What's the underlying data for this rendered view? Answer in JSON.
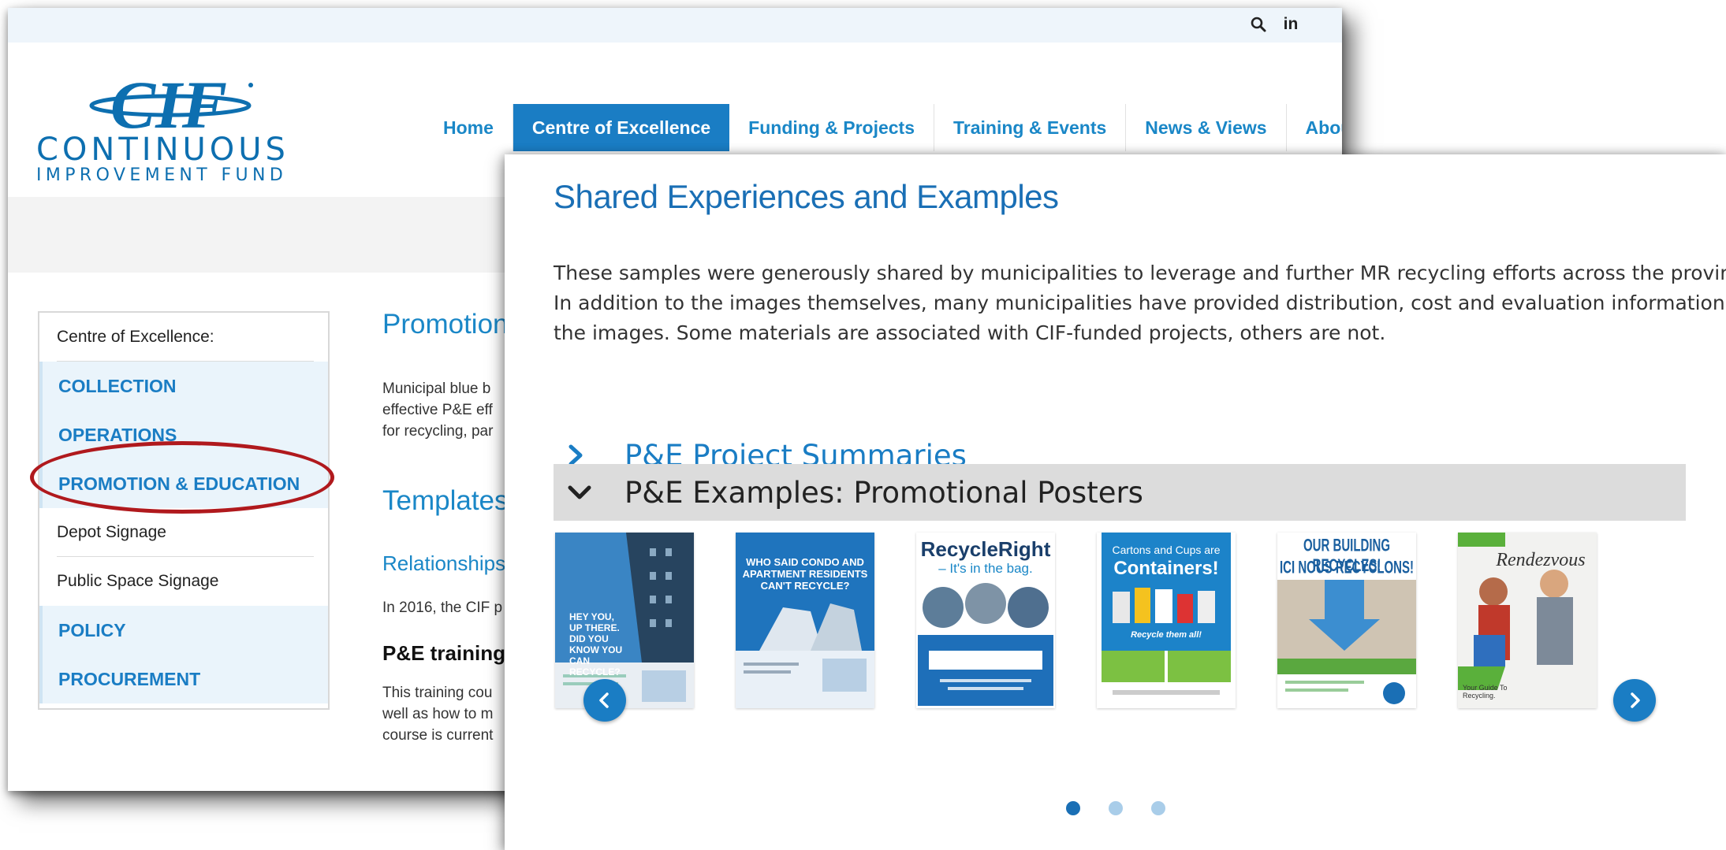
{
  "topbar": {
    "search_icon": "search-icon",
    "linkedin_label": "in"
  },
  "logo": {
    "letters": "CIF",
    "line1": "CONTINUOUS",
    "line2": "IMPROVEMENT FUND",
    "color": "#0d6fb0"
  },
  "nav": {
    "items": [
      "Home",
      "Centre of Excellence",
      "Funding & Projects",
      "Training & Events",
      "News & Views",
      "About"
    ],
    "active_index": 1,
    "active_color": "#1a7dc4"
  },
  "sidebar": {
    "heading": "Centre of Excellence:",
    "items": [
      {
        "label": "COLLECTION",
        "type": "category"
      },
      {
        "label": "OPERATIONS",
        "type": "category"
      },
      {
        "label": "PROMOTION & EDUCATION",
        "type": "category",
        "highlighted": true
      },
      {
        "label": "Depot Signage",
        "type": "sub"
      },
      {
        "label": "Public Space Signage",
        "type": "sub"
      },
      {
        "label": "POLICY",
        "type": "category"
      },
      {
        "label": "PROCUREMENT",
        "type": "category"
      }
    ],
    "highlight_color": "#b0191d"
  },
  "content_peek": {
    "heading": "Promotion",
    "para1": [
      "Municipal blue b",
      "effective P&E eff",
      "for recycling, par"
    ],
    "heading2": "Templates,",
    "subheading": "Relationships",
    "para2": "In 2016, the CIF p",
    "heading3": "P&E training c",
    "para3": [
      "This training cou",
      "well as how to m",
      "course is current"
    ]
  },
  "panel": {
    "title": "Shared Experiences and Examples",
    "intro_lines": [
      "These samples were generously shared by municipalities to leverage and further MR recycling efforts across the province.",
      "In addition to the images themselves, many municipalities have provided distribution, cost and evaluation information for",
      "the images. Some materials are associated with CIF-funded projects, others are not."
    ],
    "accordions": [
      {
        "label": "P&E Project Summaries",
        "expanded": false
      },
      {
        "label": "P&E Examples: Promotional Posters",
        "expanded": true
      }
    ]
  },
  "carousel": {
    "posters": [
      {
        "title": "HEY YOU, UP THERE. DID YOU KNOW YOU CAN RECYCLE?"
      },
      {
        "title": "WHO SAID CONDO AND APARTMENT RESIDENTS CAN'T RECYCLE?"
      },
      {
        "title": "RecycleRight",
        "subtitle": "– It's in the bag."
      },
      {
        "title": "Cartons and Cups are",
        "title2": "Containers!",
        "subtitle": "Recycle them all!"
      },
      {
        "title": "OUR BUILDING RECYCLES!",
        "title2": "ICI NOUS RECYCLONS!"
      },
      {
        "title": "Rendezvous",
        "caption": "Your Guide To Recycling."
      }
    ],
    "pages": 3,
    "active_page": 0,
    "prev_icon": "chevron-left-icon",
    "next_icon": "chevron-right-icon"
  }
}
